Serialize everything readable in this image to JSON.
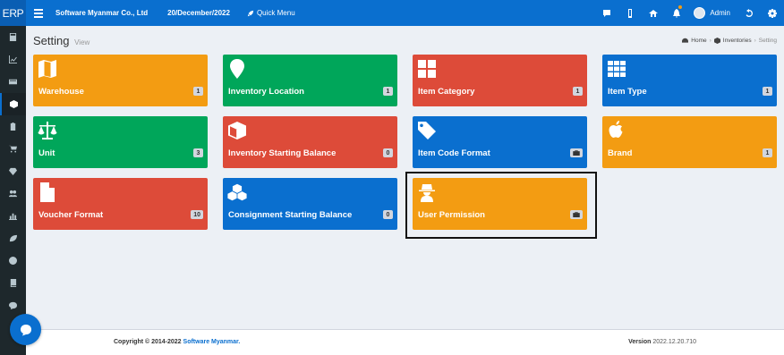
{
  "app": {
    "brand": "ERP"
  },
  "topbar": {
    "company": "Software Myanmar Co., Ltd",
    "date": "20/December/2022",
    "quick_menu": "Quick Menu",
    "user_name": "Admin",
    "icons": [
      "chat-icon",
      "mobile-icon",
      "home-icon",
      "bell-icon",
      "user-avatar",
      "history-icon",
      "gear-icon"
    ]
  },
  "sidebar": {
    "items": [
      "calculator-icon",
      "line-chart-icon",
      "credit-card-icon",
      "cube-icon",
      "clipboard-icon",
      "cart-icon",
      "diamond-icon",
      "users-icon",
      "bar-chart-icon",
      "leaf-icon",
      "support-icon",
      "book-icon",
      "comment-icon"
    ]
  },
  "page": {
    "title": "Setting",
    "subtitle": "View",
    "breadcrumb": {
      "home": "Home",
      "inventories": "Inventories",
      "current": "Setting"
    }
  },
  "tiles": [
    {
      "label": "Warehouse",
      "badge": "1",
      "color": "#f39c12",
      "icon": "map-icon"
    },
    {
      "label": "Inventory Location",
      "badge": "1",
      "color": "#00a65a",
      "icon": "map-marker-icon"
    },
    {
      "label": "Item Category",
      "badge": "1",
      "color": "#dd4b39",
      "icon": "th-large-icon"
    },
    {
      "label": "Item Type",
      "badge": "1",
      "color": "#0a6fcf",
      "icon": "th-icon"
    },
    {
      "label": "Unit",
      "badge": "3",
      "color": "#00a65a",
      "icon": "balance-scale-icon"
    },
    {
      "label": "Inventory Starting Balance",
      "badge": "0",
      "color": "#dd4b39",
      "icon": "cube-icon"
    },
    {
      "label": "Item Code Format",
      "badge": "briefcase",
      "color": "#0a6fcf",
      "icon": "tag-icon"
    },
    {
      "label": "Brand",
      "badge": "1",
      "color": "#f39c12",
      "icon": "apple-icon"
    },
    {
      "label": "Voucher Format",
      "badge": "10",
      "color": "#dd4b39",
      "icon": "file-icon"
    },
    {
      "label": "Consignment Starting Balance",
      "badge": "0",
      "color": "#0a6fcf",
      "icon": "cubes-icon"
    },
    {
      "label": "User Permission",
      "badge": "briefcase",
      "color": "#f39c12",
      "icon": "user-secret-icon"
    }
  ],
  "footer": {
    "copyright_prefix": "Copyright © 2014-2022",
    "company_link": "Software Myanmar.",
    "version_label": "Version",
    "version_value": "2022.12.20.710"
  }
}
